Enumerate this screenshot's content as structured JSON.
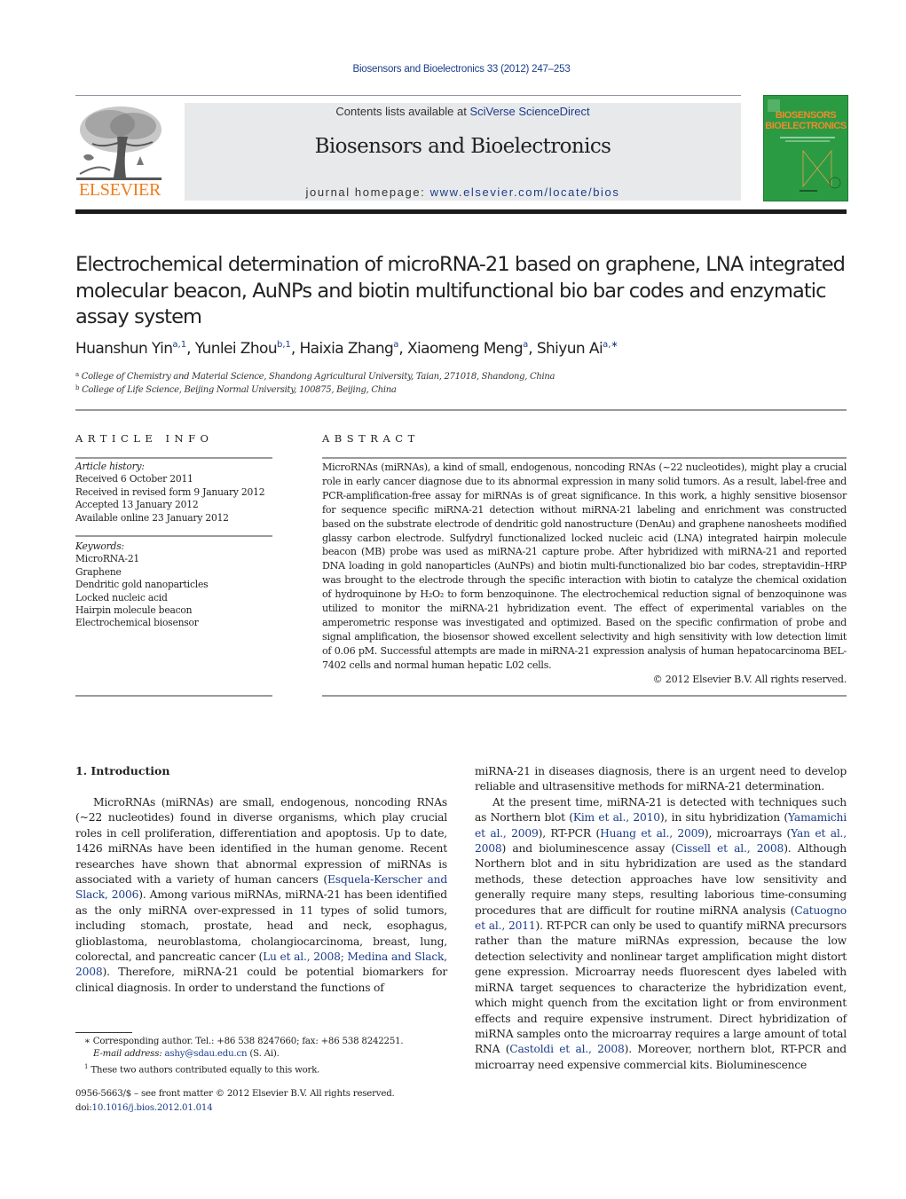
{
  "header": {
    "journal_reference": "Biosensors and Bioelectronics 33 (2012) 247–253",
    "contents_prefix": "Contents lists available at ",
    "contents_link": "SciVerse ScienceDirect",
    "journal_title": "Biosensors and Bioelectronics",
    "homepage_prefix": "journal homepage: ",
    "homepage_link": "www.elsevier.com/locate/bios",
    "publisher_logo_text": "ELSEVIER",
    "cover_title_line1": "BIOSENSORS",
    "cover_title_line2": "BIOELECTRONICS",
    "colors": {
      "link": "#1b3d8a",
      "elsevier_orange": "#f07c1b",
      "cover_green": "#2b9b43"
    }
  },
  "article": {
    "title": "Electrochemical determination of microRNA-21 based on graphene, LNA integrated molecular beacon, AuNPs and biotin multifunctional bio bar codes and enzymatic assay system",
    "authors": [
      {
        "name": "Huanshun Yin",
        "marks": "a,1"
      },
      {
        "name": "Yunlei Zhou",
        "marks": "b,1"
      },
      {
        "name": "Haixia Zhang",
        "marks": "a"
      },
      {
        "name": "Xiaomeng Meng",
        "marks": "a"
      },
      {
        "name": "Shiyun Ai",
        "marks": "a,∗"
      }
    ],
    "affiliations": [
      {
        "mark": "a",
        "text": "College of Chemistry and Material Science, Shandong Agricultural University, Taian, 271018, Shandong, China"
      },
      {
        "mark": "b",
        "text": "College of Life Science, Beijing Normal University, 100875, Beijing, China"
      }
    ]
  },
  "article_info": {
    "heading": "ARTICLE INFO",
    "history_heading": "Article history:",
    "history": [
      "Received 6 October 2011",
      "Received in revised form 9 January 2012",
      "Accepted 13 January 2012",
      "Available online 23 January 2012"
    ],
    "keywords_heading": "Keywords:",
    "keywords": [
      "MicroRNA-21",
      "Graphene",
      "Dendritic gold nanoparticles",
      "Locked nucleic acid",
      "Hairpin molecule beacon",
      "Electrochemical biosensor"
    ]
  },
  "abstract": {
    "heading": "ABSTRACT",
    "text": "MicroRNAs (miRNAs), a kind of small, endogenous, noncoding RNAs (~22 nucleotides), might play a crucial role in early cancer diagnose due to its abnormal expression in many solid tumors. As a result, label-free and PCR-amplification-free assay for miRNAs is of great significance. In this work, a highly sensitive biosensor for sequence specific miRNA-21 detection without miRNA-21 labeling and enrichment was constructed based on the substrate electrode of dendritic gold nanostructure (DenAu) and graphene nanosheets modified glassy carbon electrode. Sulfydryl functionalized locked nucleic acid (LNA) integrated hairpin molecule beacon (MB) probe was used as miRNA-21 capture probe. After hybridized with miRNA-21 and reported DNA loading in gold nanoparticles (AuNPs) and biotin multi-functionalized bio bar codes, streptavidin–HRP was brought to the electrode through the specific interaction with biotin to catalyze the chemical oxidation of hydroquinone by H₂O₂ to form benzoquinone. The electrochemical reduction signal of benzoquinone was utilized to monitor the miRNA-21 hybridization event. The effect of experimental variables on the amperometric response was investigated and optimized. Based on the specific confirmation of probe and signal amplification, the biosensor showed excellent selectivity and high sensitivity with low detection limit of 0.06 pM. Successful attempts are made in miRNA-21 expression analysis of human hepatocarcinoma BEL-7402 cells and normal human hepatic L02 cells.",
    "copyright": "© 2012 Elsevier B.V. All rights reserved."
  },
  "body": {
    "section_heading": "1.  Introduction",
    "left_column": [
      {
        "t": "MicroRNAs (miRNAs) are small, endogenous, noncoding RNAs (~22 nucleotides) found in diverse organisms, which play crucial roles in cell proliferation, differentiation and apoptosis. Up to date, 1426 miRNAs have been identified in the human genome. Recent researches have shown that abnormal expression of miRNAs is associated with a variety of human cancers ("
      },
      {
        "link": "Esquela-Kerscher and Slack, 2006"
      },
      {
        "t": "). Among various miRNAs, miRNA-21 has been identified as the only miRNA over-expressed in 11 types of solid tumors, including stomach, prostate, head and neck, esophagus, glioblastoma, neuroblastoma, cholangiocarcinoma, breast, lung, colorectal, and pancreatic cancer ("
      },
      {
        "link": "Lu et al., 2008; Medina and Slack, 2008"
      },
      {
        "t": "). Therefore, miRNA-21 could be potential biomarkers for clinical diagnosis. In order to understand the functions of"
      }
    ],
    "right_continuation": "miRNA-21 in diseases diagnosis, there is an urgent need to develop reliable and ultrasensitive methods for miRNA-21 determination.",
    "right_paragraph": [
      {
        "t": "At the present time, miRNA-21 is detected with techniques such as Northern blot ("
      },
      {
        "link": "Kim et al., 2010"
      },
      {
        "t": "), in situ hybridization ("
      },
      {
        "link": "Yamamichi et al., 2009"
      },
      {
        "t": "), RT-PCR ("
      },
      {
        "link": "Huang et al., 2009"
      },
      {
        "t": "), microarrays ("
      },
      {
        "link": "Yan et al., 2008"
      },
      {
        "t": ") and bioluminescence assay ("
      },
      {
        "link": "Cissell et al., 2008"
      },
      {
        "t": "). Although Northern blot and in situ hybridization are used as the standard methods, these detection approaches have low sensitivity and generally require many steps, resulting laborious time-consuming procedures that are difficult for routine miRNA analysis ("
      },
      {
        "link": "Catuogno et al., 2011"
      },
      {
        "t": "). RT-PCR can only be used to quantify miRNA precursors rather than the mature miRNAs expression, because the low detection selectivity and nonlinear target amplification might distort gene expression. Microarray needs fluorescent dyes labeled with miRNA target sequences to characterize the hybridization event, which might quench from the excitation light or from environment effects and require expensive instrument. Direct hybridization of miRNA samples onto the microarray requires a large amount of total RNA ("
      },
      {
        "link": "Castoldi et al., 2008"
      },
      {
        "t": "). Moreover, northern blot, RT-PCR and microarray need expensive commercial kits. Bioluminescence"
      }
    ]
  },
  "footnotes": {
    "corresponding_mark": "∗",
    "corresponding": "Corresponding author. Tel.: +86 538 8247660; fax: +86 538 8242251.",
    "email_label": "E-mail address: ",
    "email": "ashy@sdau.edu.cn",
    "email_suffix": " (S. Ai).",
    "equal_mark": "1",
    "equal_contribution": "These two authors contributed equally to this work.",
    "issn_line": "0956-5663/$ – see front matter © 2012 Elsevier B.V. All rights reserved.",
    "doi_prefix": "doi:",
    "doi": "10.1016/j.bios.2012.01.014"
  }
}
